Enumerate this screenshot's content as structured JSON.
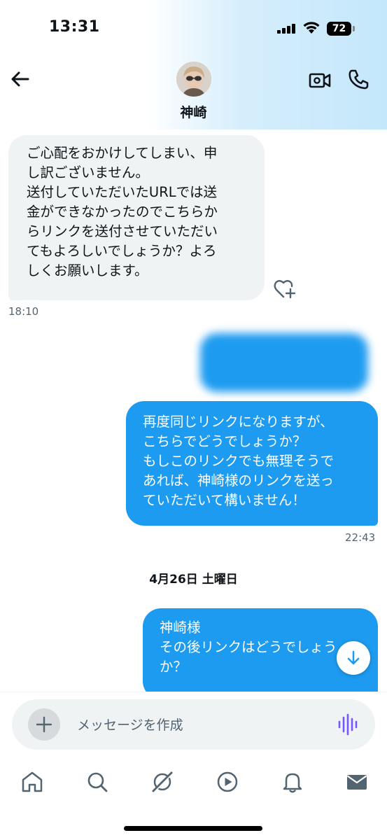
{
  "status_bar": {
    "time": "13:31",
    "battery": "72"
  },
  "header": {
    "contact_name": "神崎",
    "back_icon": "arrow-left-icon",
    "video_icon": "video-camera-icon",
    "phone_icon": "phone-icon"
  },
  "messages": [
    {
      "direction": "incoming",
      "text": "ご心配をおかけしてしまい、申\nし訳ございません。\n送付していただいたURLでは送\n金ができなかったのでこちらか\nらリンクを送付させていただい\nてもよろしいでしょうか？よろ\nしくお願いします。",
      "time": "18:10"
    },
    {
      "direction": "outgoing",
      "text": "再度同じリンクになりますが、\nこちらでどうでしょうか？\nもしこのリンクでも無理そうで\nあれば、神崎様のリンクを送っ\nていただいて構いません！",
      "time": "22:43"
    },
    {
      "direction": "outgoing",
      "text": "神崎様\nその後リンクはどうでしょう\nか？",
      "time": ""
    }
  ],
  "date_divider": "4月26日 土曜日",
  "composer": {
    "placeholder": "メッセージを作成"
  },
  "colors": {
    "accent": "#1d9bf0",
    "incoming_bubble": "#eff3f4",
    "voice_icon": "#7856ff"
  },
  "bottom_nav": [
    "home-icon",
    "search-icon",
    "grok-icon",
    "video-play-icon",
    "bell-icon",
    "mail-icon"
  ]
}
